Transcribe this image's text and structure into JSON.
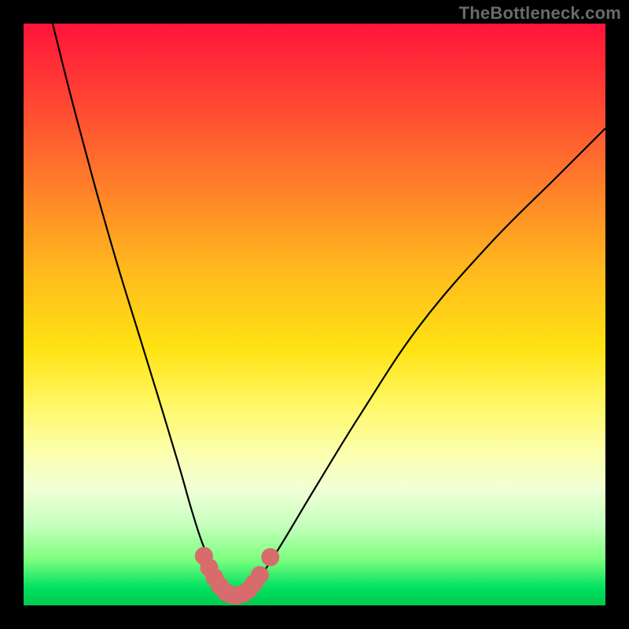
{
  "watermark": "TheBottleneck.com",
  "colors": {
    "background": "#000000",
    "curve_stroke": "#000000",
    "marker_fill": "#d86b6b",
    "marker_stroke": "#d86b6b"
  },
  "chart_data": {
    "type": "line",
    "title": "",
    "xlabel": "",
    "ylabel": "",
    "xlim": [
      0,
      100
    ],
    "ylim": [
      0,
      100
    ],
    "grid": false,
    "series": [
      {
        "name": "bottleneck-curve",
        "x": [
          5,
          8,
          12,
          16,
          20,
          24,
          27,
          29,
          31,
          33.5,
          35,
          36.5,
          38,
          40,
          44,
          50,
          58,
          68,
          80,
          92,
          100
        ],
        "y": [
          100,
          88,
          73,
          59,
          46,
          33,
          23,
          16,
          10,
          5,
          2.5,
          1.6,
          2,
          4,
          10,
          20,
          33,
          48,
          62,
          74,
          82
        ]
      }
    ],
    "markers": [
      {
        "x": 31.0,
        "y": 8.5
      },
      {
        "x": 31.9,
        "y": 6.5
      },
      {
        "x": 32.8,
        "y": 4.8
      },
      {
        "x": 33.7,
        "y": 3.4
      },
      {
        "x": 34.7,
        "y": 2.3
      },
      {
        "x": 35.7,
        "y": 1.8
      },
      {
        "x": 36.7,
        "y": 1.7
      },
      {
        "x": 37.7,
        "y": 2.0
      },
      {
        "x": 38.7,
        "y": 2.7
      },
      {
        "x": 39.6,
        "y": 3.8
      },
      {
        "x": 40.6,
        "y": 5.2
      },
      {
        "x": 42.4,
        "y": 8.3
      }
    ],
    "marker_radius_px": 11
  }
}
